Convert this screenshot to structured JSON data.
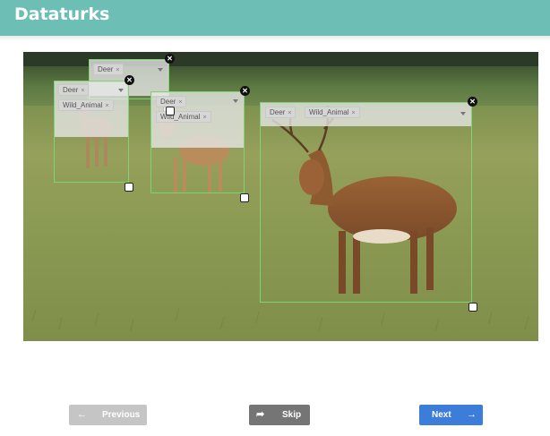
{
  "app": {
    "title": "Dataturks"
  },
  "image": {
    "description": "Deer standing in grass field"
  },
  "annotations": [
    {
      "id": "box-1",
      "tags": [
        "Deer",
        "Wild_Animal"
      ]
    },
    {
      "id": "box-2",
      "tags": [
        "Deer"
      ]
    },
    {
      "id": "box-3",
      "tags": [
        "Deer",
        "Wild_Animal"
      ]
    },
    {
      "id": "box-4",
      "tags": [
        "Deer",
        "Wild_Animal"
      ]
    }
  ],
  "chip_remove_glyph": "×",
  "close_glyph": "✕",
  "nav": {
    "previous_label": "Previous",
    "skip_label": "Skip",
    "next_label": "Next",
    "previous_icon": "arrow-left-icon",
    "skip_icon": "share-forward-icon",
    "next_icon": "arrow-right-icon"
  },
  "colors": {
    "header": "#6dbfb6",
    "box_border": "#7ed46f",
    "next_button": "#3b7dd8",
    "skip_button": "#757575",
    "previous_button": "#c5c5c5"
  }
}
